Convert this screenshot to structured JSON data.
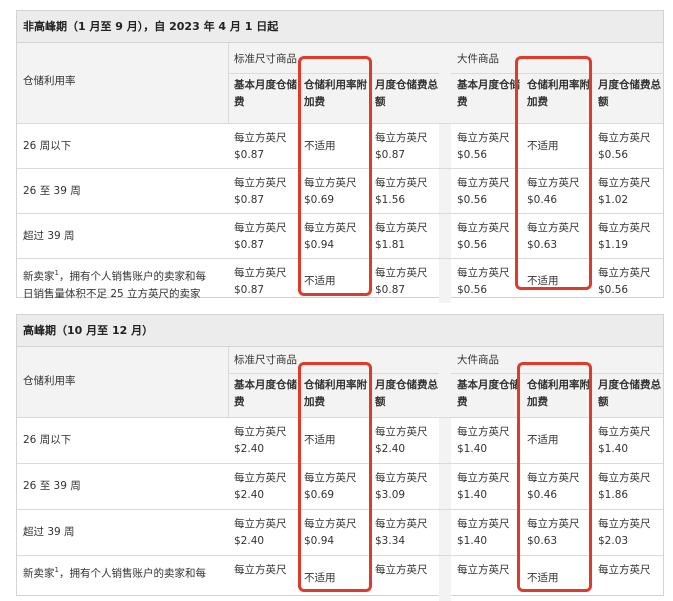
{
  "table1": {
    "title": "非高峰期（1 月至 9 月），自 2023 年 4 月 1 日起",
    "row_header": "仓储利用率",
    "group_standard": "标准尺寸商品",
    "group_oversize": "大件商品",
    "col_base": "基本月度仓储费",
    "col_surcharge": "仓储利用率附加费",
    "col_total": "月度仓储费总额",
    "rows": [
      {
        "label": "26 周以下",
        "s_base": [
          "每立方英尺",
          "$0.87"
        ],
        "s_sur": "不适用",
        "s_total": [
          "每立方英尺",
          "$0.87"
        ],
        "o_base": [
          "每立方英尺",
          "$0.56"
        ],
        "o_sur": "不适用",
        "o_total": [
          "每立方英尺",
          "$0.56"
        ]
      },
      {
        "label": "26 至 39 周",
        "s_base": [
          "每立方英尺",
          "$0.87"
        ],
        "s_sur": [
          "每立方英尺",
          "$0.69"
        ],
        "s_total": [
          "每立方英尺",
          "$1.56"
        ],
        "o_base": [
          "每立方英尺",
          "$0.56"
        ],
        "o_sur": [
          "每立方英尺",
          "$0.46"
        ],
        "o_total": [
          "每立方英尺",
          "$1.02"
        ]
      },
      {
        "label": "超过 39 周",
        "s_base": [
          "每立方英尺",
          "$0.87"
        ],
        "s_sur": [
          "每立方英尺",
          "$0.94"
        ],
        "s_total": [
          "每立方英尺",
          "$1.81"
        ],
        "o_base": [
          "每立方英尺",
          "$0.56"
        ],
        "o_sur": [
          "每立方英尺",
          "$0.63"
        ],
        "o_total": [
          "每立方英尺",
          "$1.19"
        ]
      },
      {
        "label1": "新卖家",
        "sup": "1",
        "label2": "，拥有个人销售账户的卖家和每",
        "label3": "日销售量体积不足 25 立方英尺的卖家",
        "s_base": [
          "每立方英尺",
          "$0.87"
        ],
        "s_sur": "不适用",
        "s_total": [
          "每立方英尺",
          "$0.87"
        ],
        "o_base": [
          "每立方英尺",
          "$0.56"
        ],
        "o_sur": "不适用",
        "o_total": [
          "每立方英尺",
          "$0.56"
        ]
      }
    ]
  },
  "table2": {
    "title": "高峰期（10 月至 12 月）",
    "row_header": "仓储利用率",
    "group_standard": "标准尺寸商品",
    "group_oversize": "大件商品",
    "col_base": "基本月度仓储费",
    "col_surcharge": "仓储利用率附加费",
    "col_total": "月度仓储费总额",
    "rows": [
      {
        "label": "26 周以下",
        "s_base": [
          "每立方英尺",
          "$2.40"
        ],
        "s_sur": "不适用",
        "s_total": [
          "每立方英尺",
          "$2.40"
        ],
        "o_base": [
          "每立方英尺",
          "$1.40"
        ],
        "o_sur": "不适用",
        "o_total": [
          "每立方英尺",
          "$1.40"
        ]
      },
      {
        "label": "26 至 39 周",
        "s_base": [
          "每立方英尺",
          "$2.40"
        ],
        "s_sur": [
          "每立方英尺",
          "$0.69"
        ],
        "s_total": [
          "每立方英尺",
          "$3.09"
        ],
        "o_base": [
          "每立方英尺",
          "$1.40"
        ],
        "o_sur": [
          "每立方英尺",
          "$0.46"
        ],
        "o_total": [
          "每立方英尺",
          "$1.86"
        ]
      },
      {
        "label": "超过 39 周",
        "s_base": [
          "每立方英尺",
          "$2.40"
        ],
        "s_sur": [
          "每立方英尺",
          "$0.94"
        ],
        "s_total": [
          "每立方英尺",
          "$3.34"
        ],
        "o_base": [
          "每立方英尺",
          "$1.40"
        ],
        "o_sur": [
          "每立方英尺",
          "$0.63"
        ],
        "o_total": [
          "每立方英尺",
          "$2.03"
        ]
      },
      {
        "label1": "新卖家",
        "sup": "1",
        "label2": "，拥有个人销售账户的卖家和每",
        "s_base": [
          "每立方英尺",
          ""
        ],
        "s_sur": "不适用",
        "s_total": [
          "每立方英尺",
          ""
        ],
        "o_base": [
          "每立方英尺",
          ""
        ],
        "o_sur": "不适用",
        "o_total": [
          "每立方英尺",
          ""
        ]
      }
    ]
  },
  "colors": {
    "highlight_border": "#e03a2a",
    "header_bg": "#ececec",
    "grid": "#dadada"
  }
}
